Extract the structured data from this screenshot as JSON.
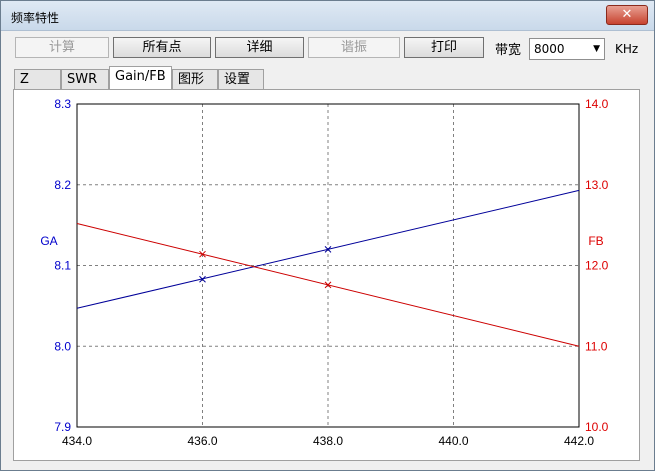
{
  "window": {
    "title": "频率特性",
    "close_symbol": "✕"
  },
  "toolbar": {
    "buttons": [
      {
        "label": "计算",
        "enabled": false
      },
      {
        "label": "所有点",
        "enabled": true
      },
      {
        "label": "详细",
        "enabled": true
      },
      {
        "label": "谐振",
        "enabled": false
      },
      {
        "label": "打印",
        "enabled": true
      }
    ],
    "bandwidth_label": "带宽",
    "bandwidth_value": "8000",
    "bandwidth_unit": "KHz"
  },
  "tabs": [
    {
      "label": "Z",
      "active": false
    },
    {
      "label": "SWR",
      "active": false
    },
    {
      "label": "Gain/FB",
      "active": true
    },
    {
      "label": "图形",
      "active": false
    },
    {
      "label": "设置",
      "active": false
    }
  ],
  "chart_data": {
    "type": "line",
    "x_ticks": [
      "434.0",
      "436.0",
      "438.0",
      "440.0",
      "442.0"
    ],
    "xlim": [
      434,
      442
    ],
    "left_axis": {
      "label": "GA",
      "ylim": [
        7.9,
        8.3
      ],
      "ticks": [
        "7.9",
        "8.0",
        "8.1",
        "8.2",
        "8.3"
      ],
      "color": "#0000cc"
    },
    "right_axis": {
      "label": "FB",
      "ylim": [
        10.0,
        14.0
      ],
      "ticks": [
        "10.0",
        "11.0",
        "12.0",
        "13.0",
        "14.0"
      ],
      "color": "#dd0000"
    },
    "grid": true,
    "series": [
      {
        "axis": "left",
        "color": "#000099",
        "x": [
          434,
          442
        ],
        "y": [
          8.047,
          8.193
        ],
        "markers_x": [
          436,
          438
        ],
        "markers_y": [
          8.083,
          8.12
        ]
      },
      {
        "axis": "right",
        "color": "#cc0000",
        "x": [
          434,
          442
        ],
        "y": [
          12.52,
          11.0
        ],
        "markers_x": [
          436,
          438
        ],
        "markers_y": [
          12.14,
          11.76
        ]
      }
    ]
  }
}
